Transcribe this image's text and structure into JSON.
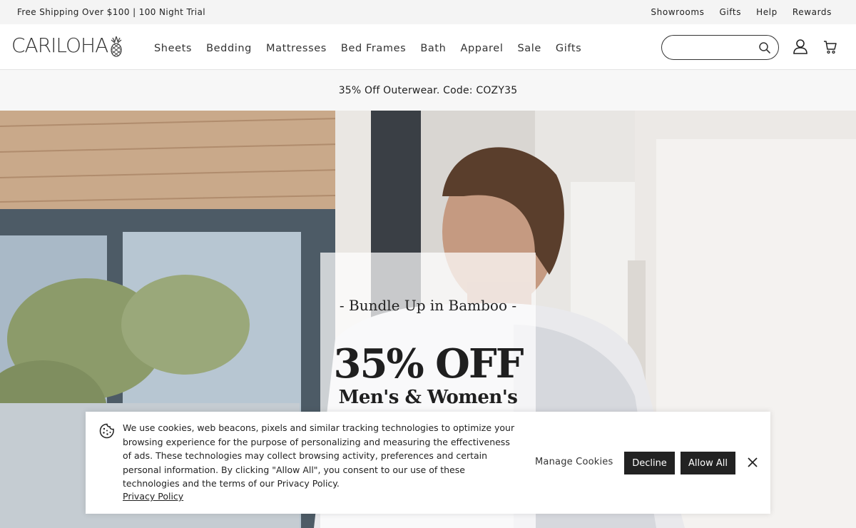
{
  "utility_bar": {
    "promo_text": "Free Shipping Over $100 | 100 Night Trial",
    "links": [
      "Showrooms",
      "Gifts",
      "Help",
      "Rewards"
    ]
  },
  "header": {
    "logo_text": "CARILOHA",
    "logo_icon": "pineapple-icon",
    "nav": [
      "Sheets",
      "Bedding",
      "Mattresses",
      "Bed Frames",
      "Bath",
      "Apparel",
      "Sale",
      "Gifts"
    ],
    "search": {
      "value": "",
      "placeholder": ""
    },
    "icons": [
      "search-icon",
      "account-icon",
      "cart-icon"
    ]
  },
  "promo_bar": {
    "text": "35% Off Outerwear. Code: COZY35"
  },
  "hero": {
    "eyebrow": "- Bundle Up in Bamboo -",
    "headline": "35% OFF",
    "subheadline": "Men's & Women's"
  },
  "cookie_banner": {
    "icon": "cookie-icon",
    "message": "We use cookies, web beacons, pixels and similar tracking technologies to optimize your browsing experience for the purpose of personalizing and measuring the effectiveness of ads. These technologies may collect browsing activity, preferences and certain personal information. By clicking \"Allow All\", you consent to our use of these technologies and the terms of our Privacy Policy.",
    "privacy_link": "Privacy Policy",
    "manage_label": "Manage Cookies",
    "decline_label": "Decline",
    "allow_label": "Allow All"
  }
}
